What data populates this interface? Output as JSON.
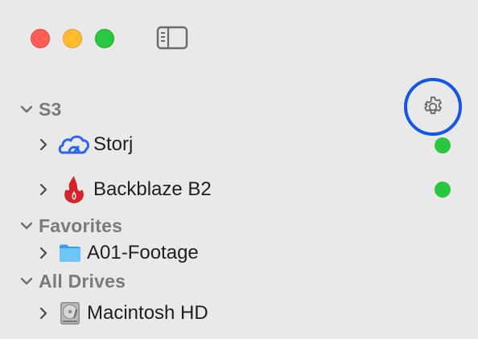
{
  "window": {
    "controls": {
      "close": "close-window",
      "minimize": "minimize-window",
      "zoom": "zoom-window"
    },
    "sidebar_toggle_icon": "sidebar-toggle-icon"
  },
  "sections": {
    "s3": {
      "label": "S3",
      "settings_icon": "gear-icon",
      "items": [
        {
          "label": "Storj",
          "icon": "storj-cloud-icon",
          "status": "online",
          "status_color": "#29c73f"
        },
        {
          "label": "Backblaze B2",
          "icon": "backblaze-flame-icon",
          "status": "online",
          "status_color": "#29c73f"
        }
      ]
    },
    "favorites": {
      "label": "Favorites",
      "items": [
        {
          "label": "A01-Footage",
          "icon": "folder-icon"
        }
      ]
    },
    "all_drives": {
      "label": "All Drives",
      "items": [
        {
          "label": "Macintosh HD",
          "icon": "hard-drive-icon"
        }
      ]
    }
  },
  "colors": {
    "background": "#e9e9e9",
    "accent_ring": "#1457e8",
    "status_online": "#29c73f",
    "storj_blue": "#2b63f6",
    "backblaze_red": "#d5232a",
    "folder_blue": "#55b7f2"
  }
}
